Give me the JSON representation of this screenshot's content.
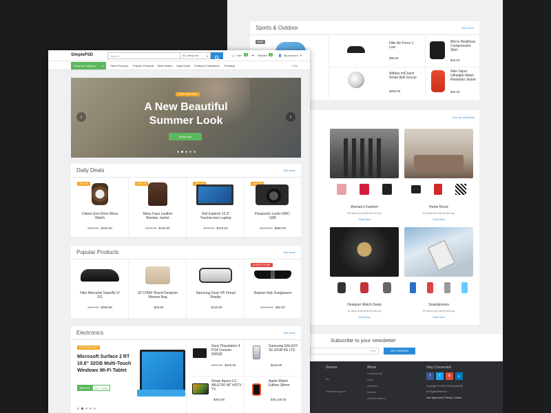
{
  "back": {
    "sports": {
      "title": "Sports & Outdoor",
      "see_more": "See more",
      "new_badge": "NEW",
      "items": [
        {
          "name": "Nike Air Force 1 Low",
          "old": "",
          "price": "$99.50"
        },
        {
          "name": "Men's HeatGear Compression Shirt",
          "old": "",
          "price": "$19.50"
        },
        {
          "name": "Adidas miCoach Smart Ball Soccer",
          "old": "",
          "price": "$260.90"
        },
        {
          "name": "Nike Vapor Ultralight Water Resistant Jacket",
          "old": "",
          "price": "$64.00"
        }
      ]
    },
    "collections": {
      "see_all": "See all collections",
      "items": [
        {
          "name": "Woman's Fashion",
          "info": "28 Items from $29.49 and Up",
          "shop": "Shop Now"
        },
        {
          "name": "Home Decor",
          "info": "52 Items from $6.99 and Up",
          "shop": "Shop Now"
        },
        {
          "name": "Designer Watch Deals",
          "info": "31 Items from $29.00 and Up",
          "shop": "Shop Now"
        },
        {
          "name": "Smartphones",
          "info": "52 Items from $6.99 and Up",
          "shop": "Shop Now"
        }
      ]
    },
    "newsletter": {
      "title": "Subscribe to your newsletter",
      "placeholder": "email",
      "button": "GET STARTED"
    },
    "footer": {
      "col1_title": "Service",
      "col1_items": [
        "ms",
        "",
        "Technical Support"
      ],
      "col2_title": "About",
      "col2_items": [
        "Company info",
        "News",
        "Investors",
        "Careers",
        "Advertise with us"
      ],
      "col3_title": "Stay Connected",
      "social": [
        "f",
        "t",
        "G",
        "in"
      ],
      "copyright": "Copyright © 1995-2016 SimplePSD",
      "rights": "All Rights Reserved",
      "legal": "User Agreement, Privacy, Cookies"
    }
  },
  "front": {
    "logo": "SimplePSD",
    "search_placeholder": "Search...",
    "categories": "All Categories",
    "cart": "Cart",
    "cart_count": "0",
    "wishlist": "Wishlist",
    "wishlist_count": "0",
    "account": "My Account",
    "shop_by_category": "Shop by Category",
    "nav": [
      "New Products",
      "Popular Products",
      "Best Sellers",
      "Daily Deals",
      "Featured Collections",
      "Trending"
    ],
    "help": "Help",
    "hero": {
      "badge": "FREE SHIPPING",
      "line1": "A New Beautiful",
      "line2": "Summer Look",
      "button": "Shop Now"
    },
    "daily": {
      "title": "Daily Deals",
      "see_more": "See more",
      "items": [
        {
          "badge": "20% Off",
          "name": "Citizen Eco-Drive Mens Watch",
          "old": "$328.90",
          "price": "$264.00"
        },
        {
          "badge": "20% Off",
          "name": "Mens Faux Leather Bomber Jacket",
          "old": "$160.90",
          "price": "$120.00"
        },
        {
          "badge": "20% Off",
          "name": "Dell Inspiron 13.3\" Touchscreen Laptop",
          "old": "$799.00",
          "price": "$478.90"
        },
        {
          "badge": "20% Off",
          "name": "Panasonic Lumix DMC-G85",
          "old": "$1000.00",
          "price": "$800.00"
        }
      ]
    },
    "popular": {
      "title": "Popular Products",
      "see_more": "See more",
      "items": [
        {
          "badge": "",
          "name": "Nike Mercurial Superfly IV FG",
          "old": "$300.00",
          "price": "$299.99"
        },
        {
          "badge": "",
          "name": "3Z CHIEF Brand Designer Women Bag",
          "old": "",
          "price": "$49.90"
        },
        {
          "badge": "",
          "name": "Samsung Gear VR Virtual Reality",
          "old": "",
          "price": "$120.00"
        },
        {
          "badge": "ALMOST GONE",
          "name": "Rayban Italy Sunglasses",
          "old": "$1000.00",
          "price": "$50.00"
        }
      ]
    },
    "electronics": {
      "title": "Electronics",
      "see_more": "See more",
      "feature": {
        "badge": "FREE SHIPPING",
        "title": "Microsoft Surface 2 RT 10.6\" 32GB Multi-Touch Windows Wi-Fi Tablet",
        "price": "$449.90",
        "buy": "BUY NOW"
      },
      "items": [
        {
          "name": "Sony Playstation 4 PS4 Console 500GB",
          "old": "$399.00",
          "price": "$349.90"
        },
        {
          "name": "Samsung GALAXY S6 32GB 4G LTE",
          "old": "",
          "price": "$249.90"
        },
        {
          "name": "Sharp Aquos LC-48LE700 48\" HDTV TV",
          "old": "",
          "price": "$363.90"
        },
        {
          "name": "Apple Watch Edition 38mm",
          "old": "",
          "price": "$25,100.00"
        }
      ]
    }
  }
}
